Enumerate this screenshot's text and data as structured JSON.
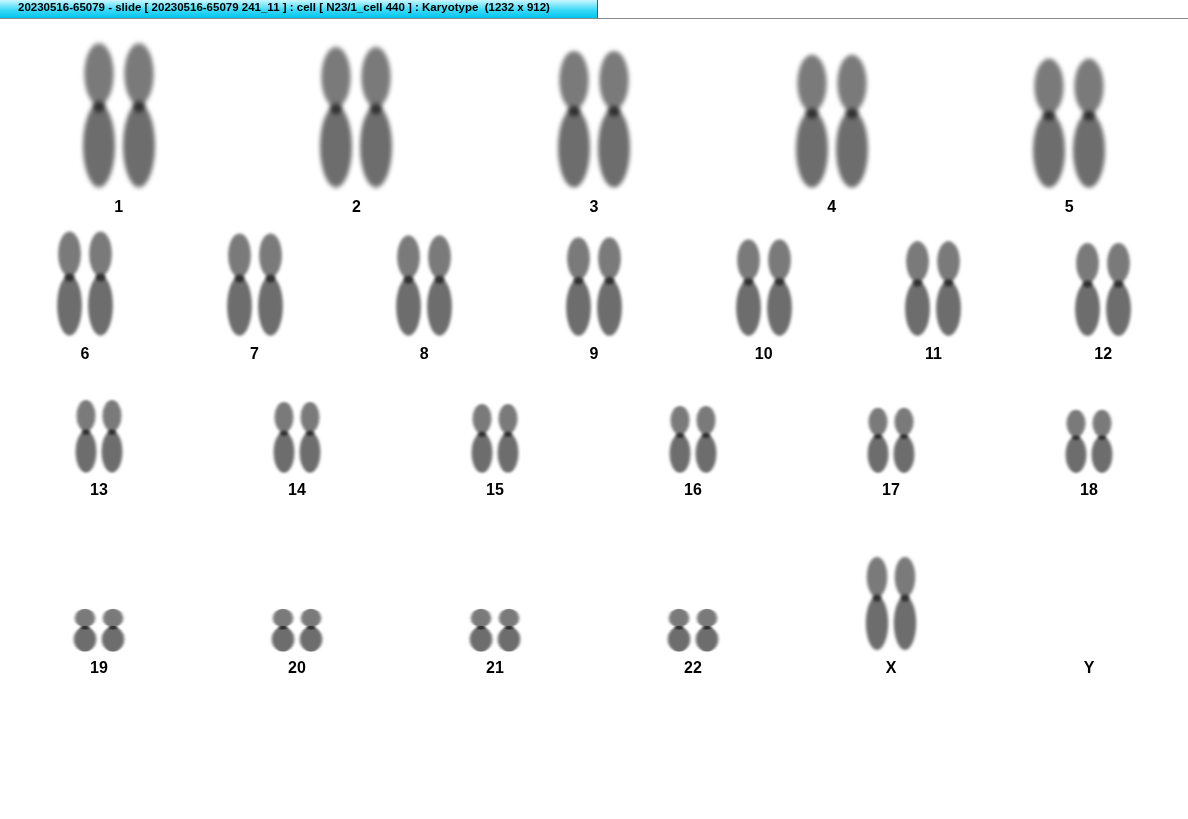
{
  "window": {
    "title": "20230516-65079 - slide [ 20230516-65079 241_11 ] : cell [ N23/1_cell 440 ] : Karyotype  (1232 x 912)"
  },
  "karyotype": {
    "rows": [
      {
        "groups": [
          {
            "label": "1",
            "kind": "pair"
          },
          {
            "label": "2",
            "kind": "pair"
          },
          {
            "label": "3",
            "kind": "pair"
          },
          {
            "label": "4",
            "kind": "pair"
          },
          {
            "label": "5",
            "kind": "pair"
          }
        ]
      },
      {
        "groups": [
          {
            "label": "6",
            "kind": "pair"
          },
          {
            "label": "7",
            "kind": "pair"
          },
          {
            "label": "8",
            "kind": "pair"
          },
          {
            "label": "9",
            "kind": "pair"
          },
          {
            "label": "10",
            "kind": "pair"
          },
          {
            "label": "11",
            "kind": "pair"
          },
          {
            "label": "12",
            "kind": "pair"
          }
        ]
      },
      {
        "groups": [
          {
            "label": "13",
            "kind": "pair"
          },
          {
            "label": "14",
            "kind": "pair"
          },
          {
            "label": "15",
            "kind": "pair"
          },
          {
            "label": "16",
            "kind": "pair"
          },
          {
            "label": "17",
            "kind": "pair"
          },
          {
            "label": "18",
            "kind": "pair"
          }
        ]
      },
      {
        "groups": [
          {
            "label": "19",
            "kind": "pair"
          },
          {
            "label": "20",
            "kind": "pair"
          },
          {
            "label": "21",
            "kind": "pair"
          },
          {
            "label": "22",
            "kind": "pair"
          },
          {
            "label": "X",
            "kind": "pair"
          },
          {
            "label": "Y",
            "kind": "empty"
          }
        ]
      }
    ]
  }
}
